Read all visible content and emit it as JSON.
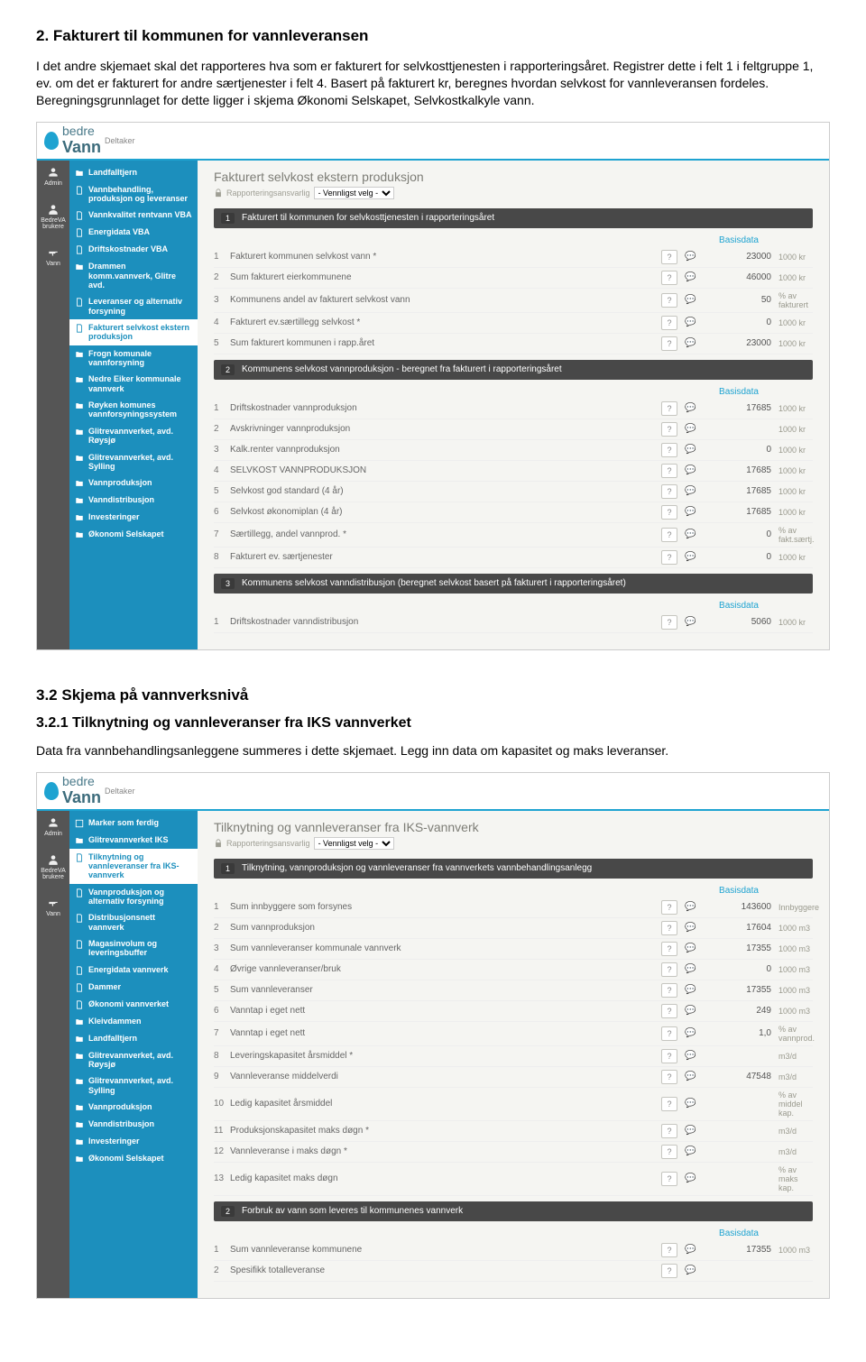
{
  "doc": {
    "h2": "2. Fakturert til kommunen for vannleveransen",
    "p1": "I det andre skjemaet skal det rapporteres hva som er fakturert for selvkosttjenesten i rapporteringsåret. Registrer dette i felt 1 i feltgruppe 1, ev. om det er fakturert for andre særtjenester i felt 4. Basert på fakturert kr, beregnes hvordan selvkost for vannleveransen fordeles. Beregningsgrunnlaget for dette ligger i skjema Økonomi Selskapet, Selvkostkalkyle vann.",
    "h3": "3.2   Skjema på vannverksnivå",
    "h4": "3.2.1   Tilknytning og vannleveranser fra IKS vannverket",
    "p2": "Data fra vannbehandlingsanleggene summeres i dette skjemaet. Legg inn data om kapasitet og maks leveranser."
  },
  "shot1": {
    "logo_brand": "bedre",
    "logo_main": "Vann",
    "logo_sub": "Deltaker",
    "iconbar": [
      {
        "label": "Admin"
      },
      {
        "label": "BedreVA brukere"
      },
      {
        "label": "Vann"
      }
    ],
    "sidebar": [
      "Landfalltjern",
      "Vannbehandling, produksjon og leveranser",
      "Vannkvalitet rentvann VBA",
      "Energidata VBA",
      "Driftskostnader VBA",
      "Drammen komm.vannverk, Glitre avd.",
      "Leveranser og alternativ forsyning",
      "Fakturert selvkost ekstern produksjon",
      "Frogn komunale vannforsyning",
      "Nedre Eiker kommunale vannverk",
      "Røyken komunes vannforsyningssystem",
      "Glitrevannverket, avd. Røysjø",
      "Glitrevannverket, avd. Sylling",
      "Vannproduksjon",
      "Vanndistribusjon",
      "Investeringer",
      "Økonomi Selskapet"
    ],
    "active_idx": 7,
    "title": "Fakturert selvkost ekstern produksjon",
    "resp_label": "Rapporteringsansvarlig",
    "resp_select": "- Vennligst velg -",
    "basis": "Basisdata",
    "sections": [
      {
        "num": "1",
        "title": "Fakturert til kommunen for selvkosttjenesten i rapporteringsåret",
        "rows": [
          {
            "n": "1",
            "l": "Fakturert kommunen selvkost vann *",
            "v": "23000",
            "u": "1000 kr"
          },
          {
            "n": "2",
            "l": "Sum fakturert eierkommunene",
            "v": "46000",
            "u": "1000 kr"
          },
          {
            "n": "3",
            "l": "Kommunens andel av fakturert selvkost vann",
            "v": "50",
            "u": "% av fakturert"
          },
          {
            "n": "4",
            "l": "Fakturert ev.særtillegg selvkost *",
            "v": "0",
            "u": "1000 kr"
          },
          {
            "n": "5",
            "l": "Sum fakturert kommunen i rapp.året",
            "v": "23000",
            "u": "1000 kr"
          }
        ]
      },
      {
        "num": "2",
        "title": "Kommunens selvkost vannproduksjon - beregnet fra fakturert i rapporteringsåret",
        "rows": [
          {
            "n": "1",
            "l": "Driftskostnader vannproduksjon",
            "v": "17685",
            "u": "1000 kr"
          },
          {
            "n": "2",
            "l": "Avskrivninger vannproduksjon",
            "v": "",
            "u": "1000 kr"
          },
          {
            "n": "3",
            "l": "Kalk.renter vannproduksjon",
            "v": "0",
            "u": "1000 kr"
          },
          {
            "n": "4",
            "l": "SELVKOST VANNPRODUKSJON",
            "v": "17685",
            "u": "1000 kr"
          },
          {
            "n": "5",
            "l": "Selvkost god standard (4 år)",
            "v": "17685",
            "u": "1000 kr"
          },
          {
            "n": "6",
            "l": "Selvkost økonomiplan (4 år)",
            "v": "17685",
            "u": "1000 kr"
          },
          {
            "n": "7",
            "l": "Særtillegg, andel vannprod. *",
            "v": "0",
            "u": "% av fakt.særtj."
          },
          {
            "n": "8",
            "l": "Fakturert ev. særtjenester",
            "v": "0",
            "u": "1000 kr"
          }
        ]
      },
      {
        "num": "3",
        "title": "Kommunens selvkost vanndistribusjon (beregnet selvkost basert på fakturert i rapporteringsåret)",
        "rows": [
          {
            "n": "1",
            "l": "Driftskostnader vanndistribusjon",
            "v": "5060",
            "u": "1000 kr"
          }
        ]
      }
    ]
  },
  "shot2": {
    "sidebar": [
      "Marker som ferdig",
      "Glitrevannverket IKS",
      "Tilknytning og vannleveranser fra IKS-vannverk",
      "Vannproduksjon og alternativ forsyning",
      "Distribusjonsnett vannverk",
      "Magasinvolum og leveringsbuffer",
      "Energidata vannverk",
      "Dammer",
      "Økonomi vannverket",
      "Kleivdammen",
      "Landfalltjern",
      "Glitrevannverket, avd. Røysjø",
      "Glitrevannverket, avd. Sylling",
      "Vannproduksjon",
      "Vanndistribusjon",
      "Investeringer",
      "Økonomi Selskapet"
    ],
    "active_idx": 2,
    "title": "Tilknytning og vannleveranser fra IKS-vannverk",
    "resp_label": "Rapporteringsansvarlig",
    "resp_select": "- Vennligst velg -",
    "basis": "Basisdata",
    "sections": [
      {
        "num": "1",
        "title": "Tilknytning, vannproduksjon og vannleveranser fra vannverkets vannbehandlingsanlegg",
        "rows": [
          {
            "n": "1",
            "l": "Sum innbyggere som forsynes",
            "v": "143600",
            "u": "Innbyggere"
          },
          {
            "n": "2",
            "l": "Sum vannproduksjon",
            "v": "17604",
            "u": "1000 m3"
          },
          {
            "n": "3",
            "l": "Sum vannleveranser kommunale vannverk",
            "v": "17355",
            "u": "1000 m3"
          },
          {
            "n": "4",
            "l": "Øvrige vannleveranser/bruk",
            "v": "0",
            "u": "1000 m3"
          },
          {
            "n": "5",
            "l": "Sum vannleveranser",
            "v": "17355",
            "u": "1000 m3"
          },
          {
            "n": "6",
            "l": "Vanntap i eget nett",
            "v": "249",
            "u": "1000 m3"
          },
          {
            "n": "7",
            "l": "Vanntap i eget nett",
            "v": "1,0",
            "u": "% av vannprod."
          },
          {
            "n": "8",
            "l": "Leveringskapasitet årsmiddel *",
            "v": "",
            "u": "m3/d"
          },
          {
            "n": "9",
            "l": "Vannleveranse middelverdi",
            "v": "47548",
            "u": "m3/d"
          },
          {
            "n": "10",
            "l": "Ledig kapasitet årsmiddel",
            "v": "",
            "u": "% av middel kap."
          },
          {
            "n": "11",
            "l": "Produksjonskapasitet maks døgn *",
            "v": "",
            "u": "m3/d"
          },
          {
            "n": "12",
            "l": "Vannleveranse i maks døgn *",
            "v": "",
            "u": "m3/d"
          },
          {
            "n": "13",
            "l": "Ledig kapasitet maks døgn",
            "v": "",
            "u": "% av maks kap."
          }
        ]
      },
      {
        "num": "2",
        "title": "Forbruk av vann som leveres til kommunenes vannverk",
        "rows": [
          {
            "n": "1",
            "l": "Sum vannleveranse kommunene",
            "v": "17355",
            "u": "1000 m3"
          },
          {
            "n": "2",
            "l": "Spesifikk totalleveranse",
            "v": "",
            "u": ""
          }
        ]
      }
    ]
  }
}
